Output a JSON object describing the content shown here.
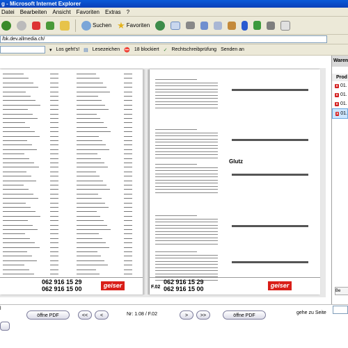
{
  "window": {
    "title": "g - Microsoft Internet Explorer"
  },
  "menu": {
    "items": [
      "Datei",
      "Bearbeiten",
      "Ansicht",
      "Favoriten",
      "Extras",
      "?"
    ]
  },
  "toolbar": {
    "search_label": "Suchen",
    "favorites_label": "Favoriten"
  },
  "address": {
    "url": "/bk.dev.allmedia.ch/"
  },
  "links": {
    "goto_label": "Los geht's!",
    "bookmarks_label": "Lesezeichen",
    "blocked_label": "18 blockiert",
    "spellcheck_label": "Rechtschreibprüfung",
    "send_label": "Senden an"
  },
  "sidebar": {
    "header": "Waren",
    "column": "Prod",
    "items": [
      "01.",
      "01.",
      "01.",
      "01."
    ],
    "button": "Be"
  },
  "catalog": {
    "left_phone_1": "062 916 15 29",
    "left_phone_2": "062 916 15 00",
    "right_phone_1": "062 916 15 29",
    "right_phone_2": "062 916 15 00",
    "logo": "geiser",
    "right_page_code": "F.02",
    "section_title": "Glutz"
  },
  "nav": {
    "pdf_left": "öffne PDF",
    "prev_prev": "<<",
    "prev": "<",
    "page_info": "Nr: 1.08 / F.02",
    "next": ">",
    "next_next": ">>",
    "pdf_right": "öffne PDF",
    "goto_label": "gehe zu Seite",
    "left_label": "l"
  },
  "colors": {
    "accent": "#0a4fc8",
    "brand": "#d91e18"
  }
}
